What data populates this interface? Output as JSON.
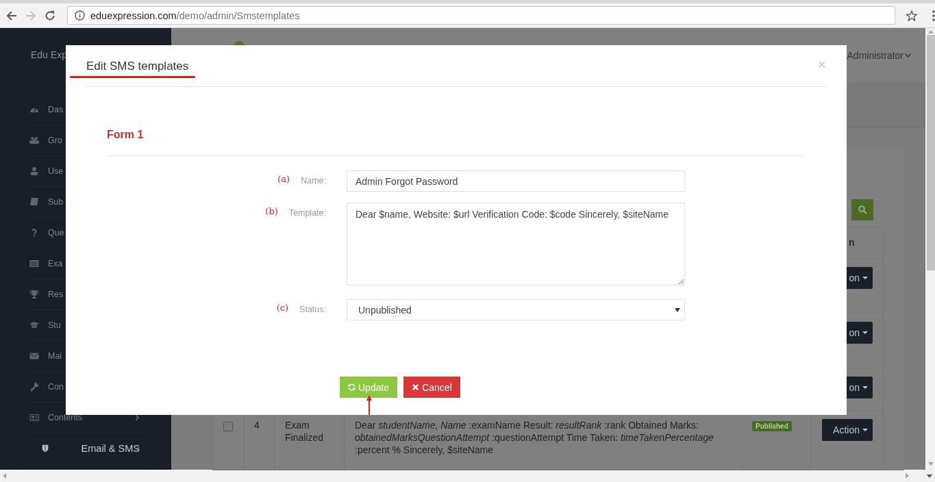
{
  "browser": {
    "nav": [
      {
        "kind": "back",
        "disabled": false
      },
      {
        "kind": "forward",
        "disabled": true
      },
      {
        "kind": "reload",
        "disabled": false
      }
    ],
    "url_host": "eduexpression.com",
    "url_path": "/demo/admin/Smstemplates"
  },
  "sidebar": {
    "brand": "Edu Exp",
    "items": [
      {
        "label": "Das",
        "selected": false
      },
      {
        "label": "Gro",
        "selected": false
      },
      {
        "label": "Use",
        "selected": false
      },
      {
        "label": "Sub",
        "selected": false
      },
      {
        "label": "Que",
        "selected": false
      },
      {
        "label": "Exa",
        "selected": false
      },
      {
        "label": "Res",
        "selected": false
      },
      {
        "label": "Stu",
        "selected": false
      },
      {
        "label": "Mai",
        "selected": false
      },
      {
        "label": "Con",
        "selected": false
      },
      {
        "label": "Contents",
        "selected": false,
        "expanded": false
      },
      {
        "label": "Email & SMS",
        "selected": true,
        "expanded": true
      }
    ]
  },
  "header": {
    "user": "Administrator"
  },
  "table": {
    "action_header": "n",
    "rows": [
      {
        "action": "on"
      },
      {
        "action": "on"
      },
      {
        "action": "on"
      },
      {
        "checked": false,
        "number": "4",
        "name": "Exam Finalized",
        "template": "Dear *studentName, Name* :examName Result: *resultRank* :rank Obtained Marks: *obtainedMarksQuestionAttempt* :questionAttempt Time Taken: *timeTakenPercentage* :percent % Sincerely, $siteName",
        "status": "Published",
        "action": "Action"
      }
    ]
  },
  "modal": {
    "title": "Edit SMS templates",
    "close": "×",
    "legend": "Form 1",
    "fields": [
      {
        "kind": "text",
        "annotation": "(a)",
        "label": "Name:",
        "value": "Admin Forgot Password"
      },
      {
        "kind": "textarea",
        "annotation": "(b)",
        "label": "Template:",
        "value": "Dear $name, Website: $url Verification Code: $code Sincerely, $siteName"
      },
      {
        "kind": "select",
        "annotation": "(c)",
        "label": "Status:",
        "value": "Unpublished"
      }
    ],
    "buttons": [
      {
        "kind": "primary",
        "label": "Update"
      },
      {
        "kind": "danger",
        "label": "Cancel"
      }
    ]
  }
}
